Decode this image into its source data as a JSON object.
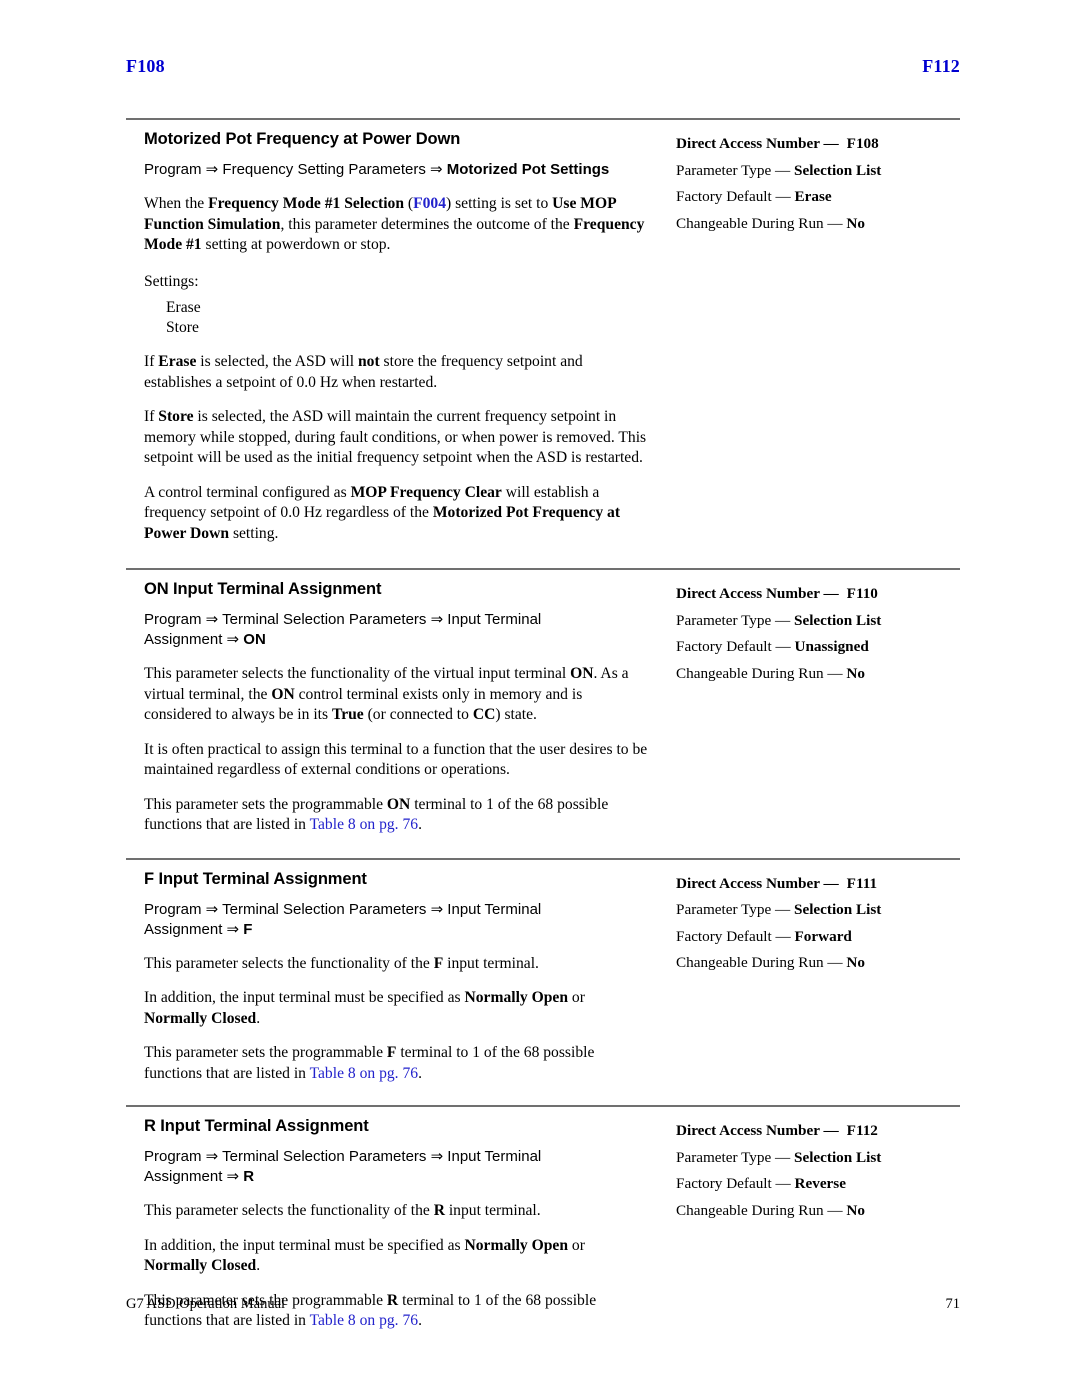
{
  "runhead": {
    "left": "F108",
    "right": "F112",
    "color": "#0000d0"
  },
  "footer": {
    "manual": "G7 ASD Operation Manual",
    "page": "71"
  },
  "meta_labels": {
    "direct_access": "Direct Access Number —",
    "parameter_type": "Parameter Type —",
    "factory_default": "Factory Default —",
    "changeable": "Changeable During Run —"
  },
  "link_color": "#2222cc",
  "sections": [
    {
      "id": "motorized-pot-frequency-at-power-down",
      "title": "Motorized Pot Frequency at Power Down",
      "navpath": {
        "plain1": "Program ⇒ Frequency Setting Parameters ⇒ ",
        "bold1": "Motorized Pot Settings"
      },
      "meta": {
        "direct_access_value": "F108",
        "parameter_type_value": "Selection List",
        "factory_default_value": "Erase",
        "changeable_value": "No"
      },
      "settings_label": "Settings:",
      "settings_options": [
        "Erase",
        "Store"
      ],
      "paragraphs": {
        "p1_a": "When the ",
        "p1_b": "Frequency Mode #1 Selection",
        "p1_c": " (",
        "p1_link": "F004",
        "p1_d": ") setting is set to ",
        "p1_e": "Use MOP Function Simulation",
        "p1_f": ", this parameter determines the outcome of the ",
        "p1_g": "Frequency Mode #1",
        "p1_h": " setting at powerdown or stop.",
        "p2_a": "If ",
        "p2_b": "Erase",
        "p2_c": " is selected, the ASD will ",
        "p2_d": "not",
        "p2_e": " store the frequency setpoint and establishes a setpoint of 0.0 Hz when restarted.",
        "p3_a": "If ",
        "p3_b": "Store",
        "p3_c": " is selected, the ASD will maintain the current frequency setpoint in memory while stopped, during fault conditions, or when power is removed. This setpoint will be used as the initial frequency setpoint when the ASD is restarted.",
        "p4_a": "A control terminal configured as ",
        "p4_b": "MOP Frequency Clear",
        "p4_c": " will establish a frequency setpoint of 0.0 Hz regardless of the ",
        "p4_d": "Motorized Pot Frequency at Power Down",
        "p4_e": " setting."
      }
    },
    {
      "id": "on-input-terminal-assignment",
      "title": "ON Input Terminal Assignment",
      "navpath": {
        "plain1": "Program ⇒ Terminal Selection Parameters ⇒ Input Terminal Assignment ⇒ ",
        "bold1": "ON"
      },
      "meta": {
        "direct_access_value": "F110",
        "parameter_type_value": "Selection List",
        "factory_default_value": "Unassigned",
        "changeable_value": "No"
      },
      "paragraphs": {
        "p1_a": "This parameter selects the functionality of the virtual input terminal ",
        "p1_b": "ON",
        "p1_c": ". As a virtual terminal, the ",
        "p1_d": "ON",
        "p1_e": " control terminal exists only in memory and is considered to always be in its ",
        "p1_f": "True",
        "p1_g": " (or connected to ",
        "p1_h": "CC",
        "p1_i": ") state.",
        "p2": "It is often practical to assign this terminal to a function that the user desires to be maintained regardless of external conditions or operations.",
        "p3_a": "This parameter sets the programmable ",
        "p3_b": "ON",
        "p3_c": " terminal to 1 of the 68 possible functions that are listed in ",
        "p3_link": "Table 8 on pg. 76",
        "p3_d": "."
      }
    },
    {
      "id": "f-input-terminal-assignment",
      "title": "F Input Terminal Assignment",
      "navpath": {
        "plain1": "Program ⇒ Terminal Selection Parameters ⇒ Input Terminal Assignment ⇒ ",
        "bold1": "F"
      },
      "meta": {
        "direct_access_value": "F111",
        "parameter_type_value": "Selection List",
        "factory_default_value": "Forward",
        "changeable_value": "No"
      },
      "paragraphs": {
        "p1_a": "This parameter selects the functionality of the ",
        "p1_b": "F",
        "p1_c": " input terminal.",
        "p2_a": "In addition, the input terminal must be specified as ",
        "p2_b": "Normally Open",
        "p2_c": " or ",
        "p2_d": "Normally Closed",
        "p2_e": ".",
        "p3_a": "This parameter sets the programmable ",
        "p3_b": "F",
        "p3_c": " terminal to 1 of the 68 possible functions that are listed in ",
        "p3_link": "Table 8 on pg. 76",
        "p3_d": "."
      }
    },
    {
      "id": "r-input-terminal-assignment",
      "title": "R Input Terminal Assignment",
      "navpath": {
        "plain1": "Program ⇒ Terminal Selection Parameters ⇒ Input Terminal Assignment ⇒ ",
        "bold1": "R"
      },
      "meta": {
        "direct_access_value": "F112",
        "parameter_type_value": "Selection List",
        "factory_default_value": "Reverse",
        "changeable_value": "No"
      },
      "paragraphs": {
        "p1_a": "This parameter selects the functionality of the ",
        "p1_b": "R",
        "p1_c": " input terminal.",
        "p2_a": "In addition, the input terminal must be specified as ",
        "p2_b": "Normally Open",
        "p2_c": " or ",
        "p2_d": "Normally Closed",
        "p2_e": ".",
        "p3_a": "This parameter sets the programmable ",
        "p3_b": "R",
        "p3_c": " terminal to 1 of the 68 possible functions that are listed in ",
        "p3_link": "Table 8 on pg. 76",
        "p3_d": "."
      }
    }
  ]
}
